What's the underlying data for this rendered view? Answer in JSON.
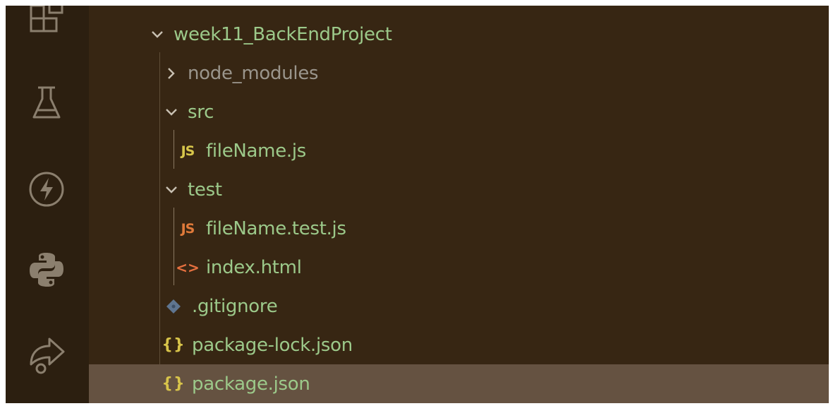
{
  "activity_bar": {
    "icons": [
      "extensions-icon",
      "testing-flask-icon",
      "lightning-icon",
      "python-icon",
      "remote-share-icon"
    ]
  },
  "explorer": {
    "root": {
      "label": "week11_BackEndProject",
      "expanded": true
    },
    "items": [
      {
        "label": "node_modules",
        "type": "folder",
        "expanded": false
      },
      {
        "label": "src",
        "type": "folder",
        "expanded": true
      },
      {
        "label": "fileName.js",
        "type": "js",
        "icon_text": "JS"
      },
      {
        "label": "test",
        "type": "folder",
        "expanded": true
      },
      {
        "label": "fileName.test.js",
        "type": "js-test",
        "icon_text": "JS"
      },
      {
        "label": "index.html",
        "type": "html",
        "icon_text": "<>"
      },
      {
        "label": ".gitignore",
        "type": "git"
      },
      {
        "label": "package-lock.json",
        "type": "json",
        "icon_text": "{}"
      },
      {
        "label": "package.json",
        "type": "json",
        "icon_text": "{}",
        "selected": true
      }
    ]
  },
  "colors": {
    "background": "#372613",
    "activity_bar": "#2c1f10",
    "selection": "#655241",
    "text": "#9cc98a",
    "dim_text": "#9a958c",
    "js_icon": "#d7c64b",
    "js_test_icon": "#e07a3a",
    "html_icon": "#e5703f",
    "json_icon": "#d8c44a"
  }
}
